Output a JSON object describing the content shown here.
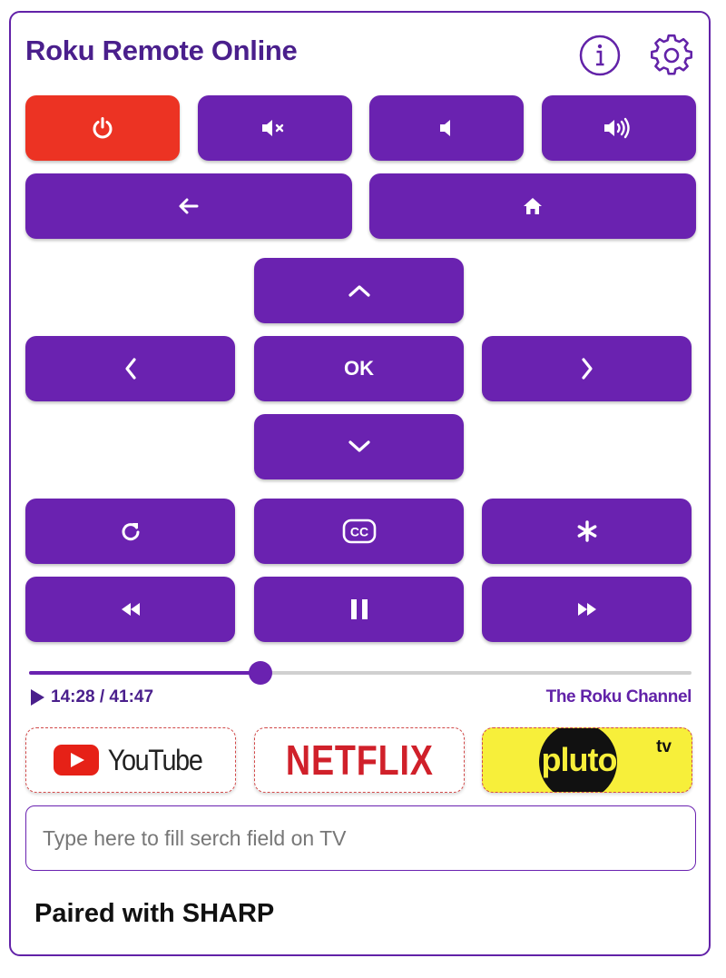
{
  "header": {
    "title": "Roku Remote Online",
    "info_icon": "info-icon",
    "settings_icon": "gear-icon"
  },
  "buttons": {
    "ok_label": "OK"
  },
  "playback": {
    "time_text": "14:28 / 41:47",
    "progress_fraction": 0.349,
    "channel": "The Roku Channel"
  },
  "apps": {
    "youtube": "YouTube",
    "netflix": "NETFLIX",
    "pluto_main": "pluto",
    "pluto_tv": "tv"
  },
  "search": {
    "placeholder": "Type here to fill serch field on TV",
    "value": ""
  },
  "status": {
    "paired_text": "Paired with SHARP"
  },
  "colors": {
    "accent": "#6a22b0",
    "title": "#4a1f8c",
    "power": "#ec3323",
    "pluto_bg": "#f7ef3a",
    "netflix_red": "#d0202a",
    "youtube_red": "#e62117"
  }
}
